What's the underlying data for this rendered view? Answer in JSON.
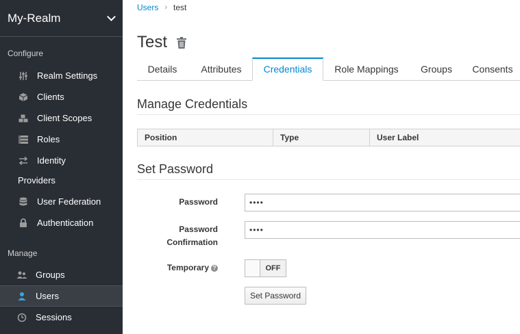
{
  "sidebar": {
    "realm": "My-Realm",
    "configure_label": "Configure",
    "manage_label": "Manage",
    "configure_items": [
      {
        "label": "Realm Settings",
        "icon": "sliders-icon"
      },
      {
        "label": "Clients",
        "icon": "cube-icon"
      },
      {
        "label": "Client Scopes",
        "icon": "cubes-icon"
      },
      {
        "label": "Roles",
        "icon": "list-icon"
      },
      {
        "label": "Identity",
        "icon": "exchange-icon"
      },
      {
        "label": "Providers",
        "icon": ""
      },
      {
        "label": "User Federation",
        "icon": "database-icon"
      },
      {
        "label": "Authentication",
        "icon": "lock-icon"
      }
    ],
    "manage_items": [
      {
        "label": "Groups",
        "icon": "users-icon"
      },
      {
        "label": "Users",
        "icon": "user-icon",
        "active": true
      },
      {
        "label": "Sessions",
        "icon": "clock-icon"
      }
    ]
  },
  "breadcrumb": {
    "parent": "Users",
    "current": "test"
  },
  "page": {
    "title": "Test"
  },
  "tabs": [
    "Details",
    "Attributes",
    "Credentials",
    "Role Mappings",
    "Groups",
    "Consents"
  ],
  "active_tab": "Credentials",
  "manage_credentials": {
    "heading": "Manage Credentials",
    "columns": [
      "Position",
      "Type",
      "User Label"
    ]
  },
  "set_password": {
    "heading": "Set Password",
    "password_label": "Password",
    "password_value": "••••",
    "confirm_label_1": "Password",
    "confirm_label_2": "Confirmation",
    "confirm_value": "••••",
    "temporary_label": "Temporary",
    "help_glyph": "?",
    "toggle_state": "OFF",
    "button_label": "Set Password"
  },
  "colors": {
    "sidebar_bg": "#292e34",
    "accent": "#0088ce",
    "active_icon": "#39a5dc"
  }
}
